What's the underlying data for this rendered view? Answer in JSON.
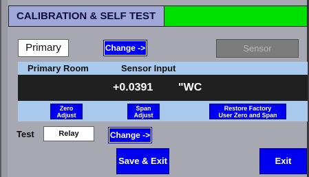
{
  "header": {
    "title": "CALIBRATION & SELF TEST",
    "status_color": "#00e000"
  },
  "primary": {
    "value": "Primary",
    "change_label": "Change ->"
  },
  "sensor_button": {
    "label": "Sensor"
  },
  "labels": {
    "primary_room": "Primary Room",
    "sensor_input": "Sensor Input"
  },
  "readout": {
    "value": "+0.0391",
    "unit": "\"WC"
  },
  "actions": {
    "zero_adjust": {
      "line1": "Zero",
      "line2": "Adjust"
    },
    "span_adjust": {
      "line1": "Span",
      "line2": "Adjust"
    },
    "restore_factory": {
      "line1": "Restore Factory",
      "line2": "User Zero and Span"
    }
  },
  "test": {
    "label": "Test",
    "value": "Relay",
    "change_label": "Change ->"
  },
  "footer": {
    "save_exit_label": "Save & Exit",
    "exit_label": "Exit"
  },
  "colors": {
    "button_blue": "#0000f0",
    "band_light_blue": "#a9c9ec",
    "readout_bg": "#202020"
  }
}
